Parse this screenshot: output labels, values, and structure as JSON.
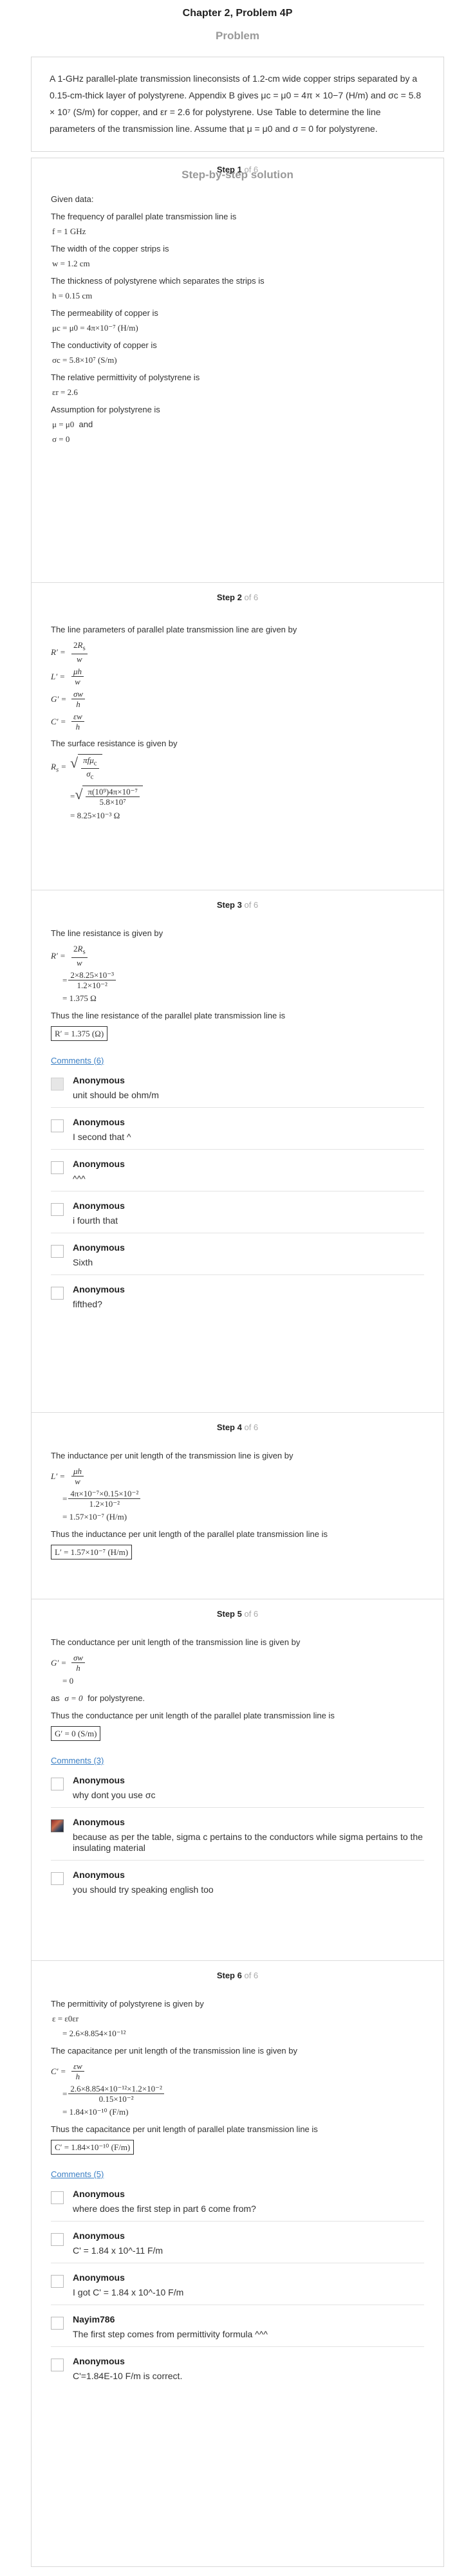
{
  "header": {
    "title": "Chapter 2, Problem 4P",
    "problem_heading": "Problem"
  },
  "problem": {
    "text": "A 1-GHz parallel-plate transmission lineconsists of 1.2-cm wide copper strips separated by a 0.15-cm-thick layer of polystyrene. Appendix B gives μc = μ0 = 4π × 10−7 (H/m) and σc = 5.8 × 10⁷ (S/m) for copper, and εr = 2.6 for polystyrene. Use Table to determine the line parameters of the transmission line. Assume that μ = μ0 and σ = 0 for polystyrene."
  },
  "solution_heading": "Step-by-step solution",
  "steps": [
    {
      "label": "Step 1",
      "of": "of 6",
      "lines": {
        "given": "Given data:",
        "freq_text": "The frequency of parallel plate transmission line is",
        "freq_eq": "f = 1 GHz",
        "width_text": "The width of the copper strips is",
        "width_eq": "w = 1.2 cm",
        "thick_text": "The thickness of polystyrene which separates the strips is",
        "thick_eq": "h = 0.15 cm",
        "perm_text": "The permeability of copper is",
        "perm_eq": "μc = μ0 = 4π×10⁻⁷ (H/m)",
        "cond_text": "The conductivity of copper is",
        "cond_eq": "σc = 5.8×10⁷ (S/m)",
        "rel_text": "The relative permittivity of polystyrene is",
        "rel_eq": "εr = 2.6",
        "assume_text": "Assumption for polystyrene is",
        "assume_eq1": "μ = μ0",
        "assume_and": "and",
        "assume_eq2": "σ = 0"
      }
    },
    {
      "label": "Step 2",
      "of": "of 6",
      "lines": {
        "intro": "The line parameters of parallel plate transmission line are given by",
        "rs_text": "The surface resistance is given by",
        "rs_result": "= 8.25×10⁻³ Ω"
      }
    },
    {
      "label": "Step 3",
      "of": "of 6",
      "lines": {
        "intro": "The line resistance is given by",
        "num": "2×8.25×10⁻³",
        "den": "1.2×10⁻²",
        "result": "= 1.375 Ω",
        "thus": "Thus the line resistance of the parallel plate transmission line is",
        "boxed": "R′ = 1.375 (Ω)"
      },
      "comments_link": "Comments (6)",
      "comments": [
        {
          "author": "Anonymous",
          "text": "unit should be ohm/m"
        },
        {
          "author": "Anonymous",
          "text": "I second that ^"
        },
        {
          "author": "Anonymous",
          "text": "^^^"
        },
        {
          "author": "Anonymous",
          "text": "i fourth that"
        },
        {
          "author": "Anonymous",
          "text": "Sixth"
        },
        {
          "author": "Anonymous",
          "text": "fifthed?"
        }
      ]
    },
    {
      "label": "Step 4",
      "of": "of 6",
      "lines": {
        "intro": "The inductance per unit length of the transmission line is given by",
        "num": "4π×10⁻⁷×0.15×10⁻²",
        "den": "1.2×10⁻²",
        "result": "= 1.57×10⁻⁷ (H/m)",
        "thus": "Thus the inductance per unit length of the parallel plate transmission line is",
        "boxed": "L′ = 1.57×10⁻⁷ (H/m)"
      }
    },
    {
      "label": "Step 5",
      "of": "of 6",
      "lines": {
        "intro": "The conductance per unit length of the transmission line is given by",
        "zero": "= 0",
        "as_text": "as",
        "as_eq": "σ = 0",
        "as_tail": "for polystyrene.",
        "thus": "Thus the conductance per unit length of the parallel plate transmission line is",
        "boxed": "G′ = 0 (S/m)"
      },
      "comments_link": "Comments (3)",
      "comments": [
        {
          "author": "Anonymous",
          "text": "why dont you use σc"
        },
        {
          "author": "Anonymous",
          "text": "because as per the table, sigma c pertains to the conductors while sigma pertains to the insulating material"
        },
        {
          "author": "Anonymous",
          "text": "you should try speaking english too"
        }
      ]
    },
    {
      "label": "Step 6",
      "of": "of 6",
      "lines": {
        "intro": "The permittivity of polystyrene is given by",
        "eps_eq": "ε = ε0εr",
        "eps_val": "= 2.6×8.854×10⁻¹²",
        "cap_text": "The capacitance per unit length of the transmission line is given by",
        "num": "2.6×8.854×10⁻¹²×1.2×10⁻²",
        "den": "0.15×10⁻²",
        "result": "= 1.84×10⁻¹⁰ (F/m)",
        "thus": "Thus the capacitance per unit length of parallel plate transmission line is",
        "boxed": "C′ = 1.84×10⁻¹⁰ (F/m)"
      },
      "comments_link": "Comments (5)",
      "comments": [
        {
          "author": "Anonymous",
          "text": "where does the first step in part 6 come from?"
        },
        {
          "author": "Anonymous",
          "text": "C' = 1.84 x 10^-11 F/m"
        },
        {
          "author": "Anonymous",
          "text": "I got C' = 1.84 x 10^-10 F/m"
        },
        {
          "author": "Nayim786",
          "text": "The first step comes from permittivity formula ^^^"
        },
        {
          "author": "Anonymous",
          "text": "C'=1.84E-10 F/m is correct."
        }
      ]
    }
  ]
}
